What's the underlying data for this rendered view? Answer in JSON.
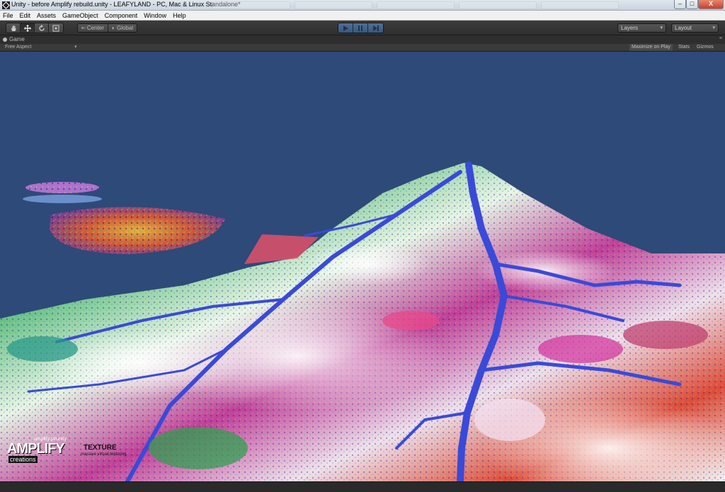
{
  "window": {
    "title": "Unity - before Amplify rebuild.unity - LEAFYLAND - PC, Mac & Linux Standalone*",
    "controls": {
      "minimize": "–",
      "maximize": "□",
      "close": "X"
    }
  },
  "menu": [
    "File",
    "Edit",
    "Assets",
    "GameObject",
    "Component",
    "Window",
    "Help"
  ],
  "toolbar": {
    "pivot": {
      "center_label": "Center",
      "global_label": "Global"
    },
    "layers_label": "Layers",
    "layout_label": "Layout"
  },
  "game_view": {
    "tab_label": "Game",
    "aspect_label": "Free Aspect",
    "maximize_label": "Maximize on Play",
    "stats_label": "Stats",
    "gizmos_label": "Gizmos",
    "watermark": {
      "url": "amplify.pt/unity",
      "brand_line1": "AMPLIFY",
      "brand_line2": "creations",
      "product": "TEXTURE",
      "product_sub": "massive virtual texturing"
    }
  },
  "colors": {
    "sky": "#2e4a78",
    "play_accent": "#3a6ea5"
  }
}
